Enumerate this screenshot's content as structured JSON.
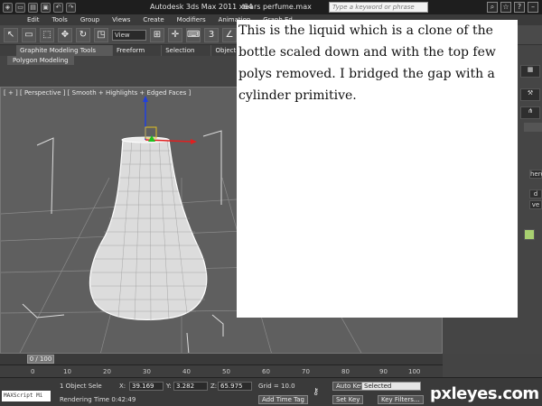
{
  "window": {
    "title": "Autodesk 3ds Max  2011 x64",
    "file_name": "tears perfume.max",
    "search_placeholder": "Type a keyword or phrase"
  },
  "menu": [
    "Edit",
    "Tools",
    "Group",
    "Views",
    "Create",
    "Modifiers",
    "Animation",
    "Graph Ed"
  ],
  "toolbar": {
    "view_select": "View",
    "snap_label": "3"
  },
  "ribbon": {
    "tabs": [
      "Graphite Modeling Tools",
      "Freeform",
      "Selection",
      "Object Paint"
    ],
    "subtab": "Polygon Modeling"
  },
  "viewport": {
    "label": "[ + ] [ Perspective ] [ Smooth + Highlights + Edged Faces ]"
  },
  "note": {
    "text": "This is the liquid which is a clone of the bottle scaled down and with the top few polys removed. I bridged the gap with a cylinder primitive."
  },
  "timeline": {
    "slider_label": "0 / 100",
    "ticks": [
      "0",
      "10",
      "20",
      "30",
      "40",
      "50",
      "60",
      "70",
      "80",
      "90",
      "100"
    ]
  },
  "status": {
    "maxscript": "MAXScript Mi",
    "selection": "1 Object Sele",
    "rendering_time": "Rendering Time  0:42:49",
    "x_label": "X:",
    "x_value": "39.169",
    "y_label": "Y:",
    "y_value": "3.282",
    "z_label": "Z:",
    "z_value": "65.975",
    "grid": "Grid = 10.0",
    "add_time_tag": "Add Time Tag",
    "auto_key": "Auto Key",
    "selected": "Selected",
    "set_key": "Set Key",
    "key_filters": "Key Filters..."
  },
  "cmdpanel": {
    "btn_here": "here",
    "btn_d": "d",
    "btn_ve": "ve"
  },
  "watermark": "pxleyes.com",
  "colors": {
    "ui_dark": "#3a3a3a",
    "viewport_bg": "#5f5f5f",
    "wire": "#ffffff",
    "axis_x": "#e02020",
    "axis_y": "#20c020",
    "axis_z": "#2040e0"
  }
}
